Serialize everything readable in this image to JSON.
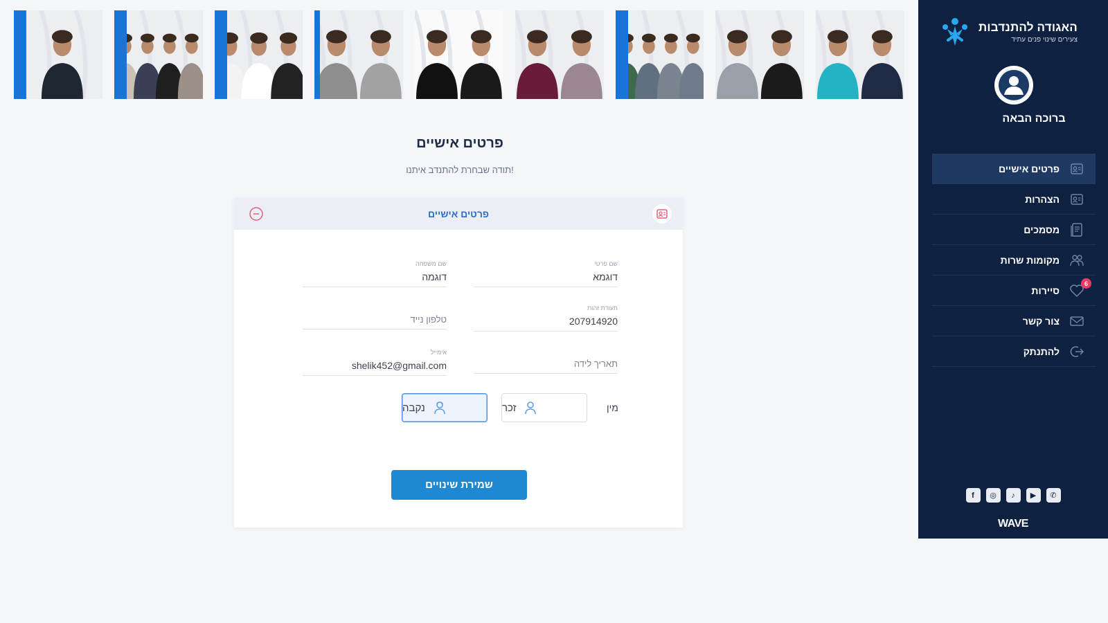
{
  "photos": [
    {
      "name": "photo-1"
    },
    {
      "name": "photo-2"
    },
    {
      "name": "photo-3"
    },
    {
      "name": "photo-4"
    },
    {
      "name": "photo-5"
    },
    {
      "name": "photo-6"
    },
    {
      "name": "photo-7"
    },
    {
      "name": "photo-8"
    },
    {
      "name": "photo-9"
    }
  ],
  "sidebar": {
    "brand_name": "האגודה להתנדבות",
    "brand_tagline": "צעירים שינוי פנים עתיד",
    "welcome": "ברוכה הבאה",
    "items": [
      {
        "label": "פרטים אישיים",
        "icon": "profile-card-icon",
        "active": true
      },
      {
        "label": "הצהרות",
        "icon": "declaration-icon"
      },
      {
        "label": "מסמכים",
        "icon": "documents-icon"
      },
      {
        "label": "מקומות שרות",
        "icon": "people-icon"
      },
      {
        "label": "סיירות",
        "icon": "heart-icon",
        "badge": "6"
      },
      {
        "label": "צור קשר",
        "icon": "mail-icon"
      },
      {
        "label": "להתנתק",
        "icon": "logout-icon"
      }
    ],
    "socials": [
      "whatsapp-icon",
      "youtube-icon",
      "tiktok-icon",
      "instagram-icon",
      "facebook-icon"
    ],
    "footer_logo": "WAVE"
  },
  "main": {
    "title": "פרטים אישיים",
    "subtitle": "תודה שבחרת להתנדב איתנו!",
    "card_title": "פרטים אישיים",
    "fields": {
      "first_name": {
        "label": "שם פרטי",
        "value": "דוגמא"
      },
      "last_name": {
        "label": "שם משפחה",
        "value": "דוגמה"
      },
      "id_number": {
        "label": "תעודת זהות",
        "value": "207914920"
      },
      "mobile": {
        "placeholder": "טלפון נייד"
      },
      "birth_date": {
        "placeholder": "תאריך לידה"
      },
      "email": {
        "label": "אימייל",
        "value": "shelik452@gmail.com"
      }
    },
    "gender": {
      "label": "מין",
      "male": "זכר",
      "female": "נקבה",
      "selected": "female"
    },
    "save_label": "שמירת שינויים"
  },
  "colors": {
    "sidebar_bg": "#0f2140",
    "accent": "#1e88d2",
    "badge": "#ef3b63"
  }
}
